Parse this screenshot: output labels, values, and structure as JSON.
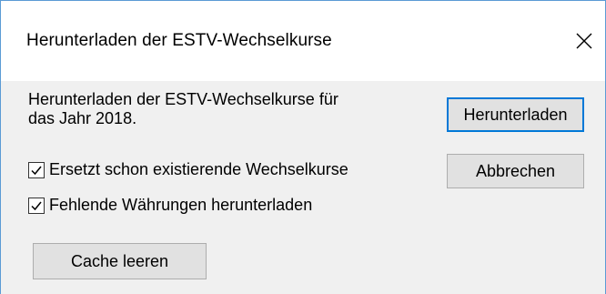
{
  "dialog": {
    "title": "Herunterladen der ESTV-Wechselkurse",
    "message_line1": "Herunterladen der ESTV-Wechselkurse für",
    "message_line2": "das Jahr 2018.",
    "checkboxes": [
      {
        "label": "Ersetzt schon existierende Wechselkurse",
        "checked": true
      },
      {
        "label": "Fehlende Währungen herunterladen",
        "checked": true
      }
    ],
    "buttons": {
      "download": "Herunterladen",
      "cancel": "Abbrechen",
      "clear_cache": "Cache leeren"
    },
    "icons": {
      "close": "close-icon",
      "check": "checkmark-icon"
    },
    "colors": {
      "accent": "#0078d7",
      "window_border": "#5b9bd5",
      "dialog_background": "#f0f0f0",
      "button_face": "#e1e1e1"
    }
  }
}
